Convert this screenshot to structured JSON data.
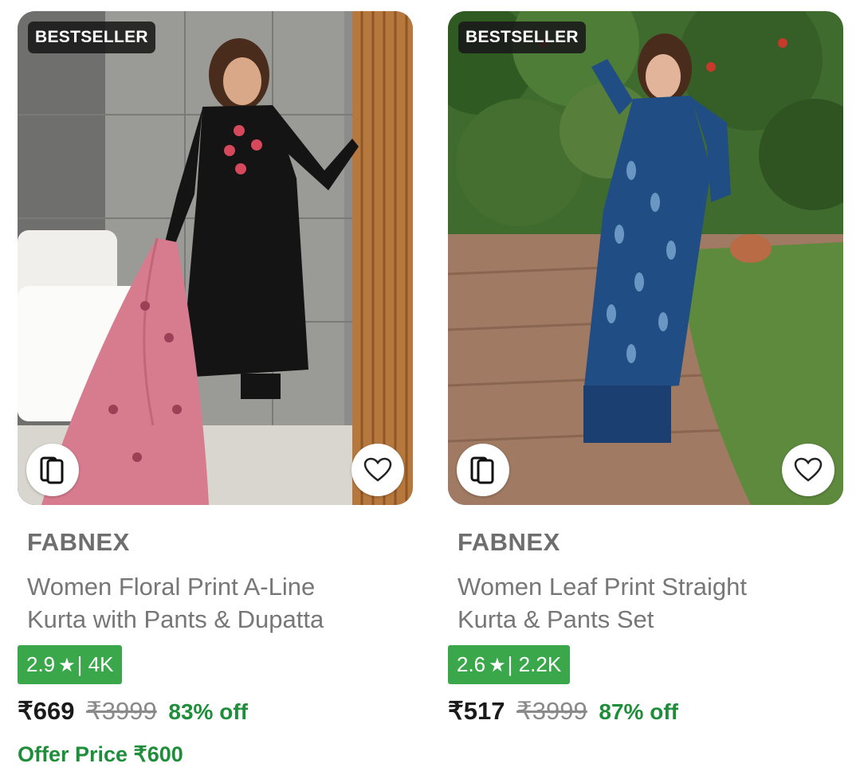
{
  "products": [
    {
      "badge": "BESTSELLER",
      "brand": "FABNEX",
      "title_line1": "Women Floral Print A-Line",
      "title_line2": "Kurta with Pants & Dupatta",
      "rating": "2.9",
      "star": "★",
      "rating_sep": "|",
      "rating_count": "4K",
      "price": "₹669",
      "mrp": "₹3999",
      "discount": "83% off",
      "offer_price": "Offer Price ₹600"
    },
    {
      "badge": "BESTSELLER",
      "brand": "FABNEX",
      "title_line1": "Women Leaf Print Straight",
      "title_line2": "Kurta & Pants Set",
      "rating": "2.6",
      "star": "★",
      "rating_sep": "|",
      "rating_count": "2.2K",
      "price": "₹517",
      "mrp": "₹3999",
      "discount": "87% off"
    }
  ],
  "icons": {
    "similar": "similar-products-icon",
    "wishlist": "heart-icon"
  },
  "colors": {
    "rating_bg": "#3aa84a",
    "discount": "#1f8e3a",
    "offer": "#1f8e3a",
    "badge_bg": "#191919"
  }
}
